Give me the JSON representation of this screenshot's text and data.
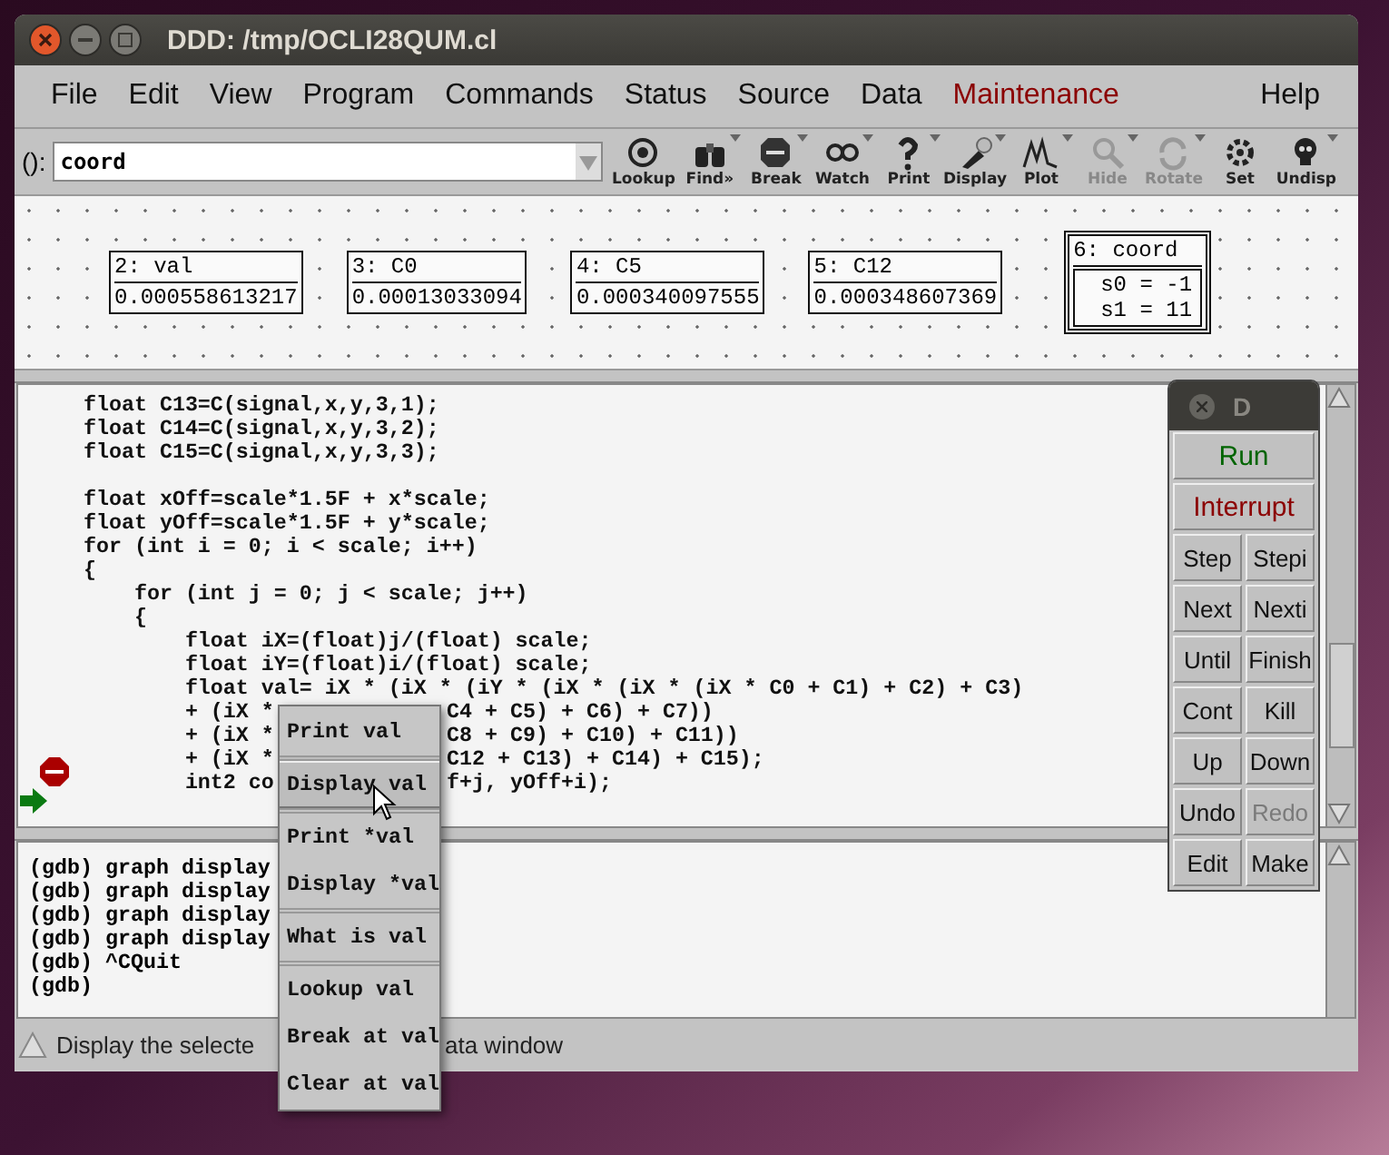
{
  "window": {
    "title": "DDD: /tmp/OCLI28QUM.cl"
  },
  "menubar": [
    {
      "label": "File",
      "kind": "normal"
    },
    {
      "label": "Edit",
      "kind": "normal"
    },
    {
      "label": "View",
      "kind": "normal"
    },
    {
      "label": "Program",
      "kind": "normal"
    },
    {
      "label": "Commands",
      "kind": "normal"
    },
    {
      "label": "Status",
      "kind": "normal"
    },
    {
      "label": "Source",
      "kind": "normal"
    },
    {
      "label": "Data",
      "kind": "normal"
    },
    {
      "label": "Maintenance",
      "kind": "maintenance"
    },
    {
      "label": "Help",
      "kind": "help"
    }
  ],
  "argument": {
    "label": "():",
    "value": "coord"
  },
  "toolbar": [
    {
      "label": "Lookup",
      "disabled": false,
      "has_menu": false
    },
    {
      "label": "Find»",
      "disabled": false,
      "has_menu": true
    },
    {
      "label": "Break",
      "disabled": false,
      "has_menu": true
    },
    {
      "label": "Watch",
      "disabled": false,
      "has_menu": true
    },
    {
      "label": "Print",
      "disabled": false,
      "has_menu": true
    },
    {
      "label": "Display",
      "disabled": false,
      "has_menu": true
    },
    {
      "label": "Plot",
      "disabled": false,
      "has_menu": true
    },
    {
      "label": "Hide",
      "disabled": true,
      "has_menu": true
    },
    {
      "label": "Rotate",
      "disabled": true,
      "has_menu": true
    },
    {
      "label": "Set",
      "disabled": false,
      "has_menu": false
    },
    {
      "label": "Undisp",
      "disabled": false,
      "has_menu": true
    }
  ],
  "displays": [
    {
      "kind": "simple",
      "title": "2: val",
      "value": "0.000558613217"
    },
    {
      "kind": "simple",
      "title": "3: C0",
      "value": "0.00013033094"
    },
    {
      "kind": "simple",
      "title": "4: C5",
      "value": "0.000340097555"
    },
    {
      "kind": "simple",
      "title": "5: C12",
      "value": "0.000348607369"
    },
    {
      "kind": "struct",
      "title": "6: coord",
      "fields": [
        "s0 = -1",
        "s1 = 11"
      ]
    }
  ],
  "source": [
    {
      "kind": "code",
      "text": "    float C13=C(signal,x,y,3,1);"
    },
    {
      "kind": "code",
      "text": "    float C14=C(signal,x,y,3,2);"
    },
    {
      "kind": "code",
      "text": "    float C15=C(signal,x,y,3,3);"
    },
    {
      "kind": "blank"
    },
    {
      "kind": "code",
      "text": "    float xOff=scale*1.5F + x*scale;"
    },
    {
      "kind": "code",
      "text": "    float yOff=scale*1.5F + y*scale;"
    },
    {
      "kind": "code",
      "text": "    for (int i = 0; i < scale; i++)"
    },
    {
      "kind": "code",
      "text": "    {"
    },
    {
      "kind": "code",
      "text": "        for (int j = 0; j < scale; j++)"
    },
    {
      "kind": "code",
      "text": "        {"
    },
    {
      "kind": "code",
      "text": "            float iX=(float)j/(float) scale;"
    },
    {
      "kind": "code",
      "text": "            float iY=(float)i/(float) scale;"
    },
    {
      "kind": "code",
      "text": "            float val= iX * (iX * (iY * (iX * (iX * (iX * C0 + C1) + C2) + C3)"
    },
    {
      "kind": "code",
      "text": "            + (iX * ",
      "right": "C4 + C5) + C6) + C7))"
    },
    {
      "kind": "code",
      "text": "            + (iX * ",
      "right": "C8 + C9) + C10) + C11))"
    },
    {
      "kind": "code",
      "text": "            + (iX * ",
      "right": "C12 + C13) + C14) + C15);"
    },
    {
      "kind": "breakpoint",
      "text": "            int2 co",
      "right": "f+j, yOff+i);"
    },
    {
      "kind": "current"
    }
  ],
  "console": [
    "(gdb) graph display",
    "(gdb) graph display",
    "(gdb) graph display",
    "(gdb) graph display",
    "(gdb) ^CQuit",
    "(gdb)"
  ],
  "status_bar": {
    "left": "Display the selecte",
    "right": "ata window"
  },
  "popup_menu": [
    {
      "label": "Print val",
      "selected": false,
      "separator_before": false
    },
    {
      "label": "Display val",
      "selected": true,
      "separator_before": true
    },
    {
      "label": "Print *val",
      "selected": false,
      "separator_before": true
    },
    {
      "label": "Display *val",
      "selected": false,
      "separator_before": false
    },
    {
      "label": "What is val",
      "selected": false,
      "separator_before": true
    },
    {
      "label": "Lookup val",
      "selected": false,
      "separator_before": true
    },
    {
      "label": "Break at val",
      "selected": false,
      "separator_before": false
    },
    {
      "label": "Clear at val",
      "selected": false,
      "separator_before": false
    }
  ],
  "command_tool": {
    "title": "D",
    "buttons": [
      {
        "label": "Run",
        "kind": "run",
        "disabled": false
      },
      {
        "label": "Interrupt",
        "kind": "interrupt",
        "disabled": false
      },
      {
        "label": "Step",
        "kind": "normal",
        "disabled": false
      },
      {
        "label": "Stepi",
        "kind": "normal",
        "disabled": false
      },
      {
        "label": "Next",
        "kind": "normal",
        "disabled": false
      },
      {
        "label": "Nexti",
        "kind": "normal",
        "disabled": false
      },
      {
        "label": "Until",
        "kind": "normal",
        "disabled": false
      },
      {
        "label": "Finish",
        "kind": "normal",
        "disabled": false
      },
      {
        "label": "Cont",
        "kind": "normal",
        "disabled": false
      },
      {
        "label": "Kill",
        "kind": "normal",
        "disabled": false
      },
      {
        "label": "Up",
        "kind": "normal",
        "disabled": false
      },
      {
        "label": "Down",
        "kind": "normal",
        "disabled": false
      },
      {
        "label": "Undo",
        "kind": "normal",
        "disabled": false
      },
      {
        "label": "Redo",
        "kind": "normal",
        "disabled": true
      },
      {
        "label": "Edit",
        "kind": "normal",
        "disabled": false
      },
      {
        "label": "Make",
        "kind": "normal",
        "disabled": false
      }
    ]
  }
}
